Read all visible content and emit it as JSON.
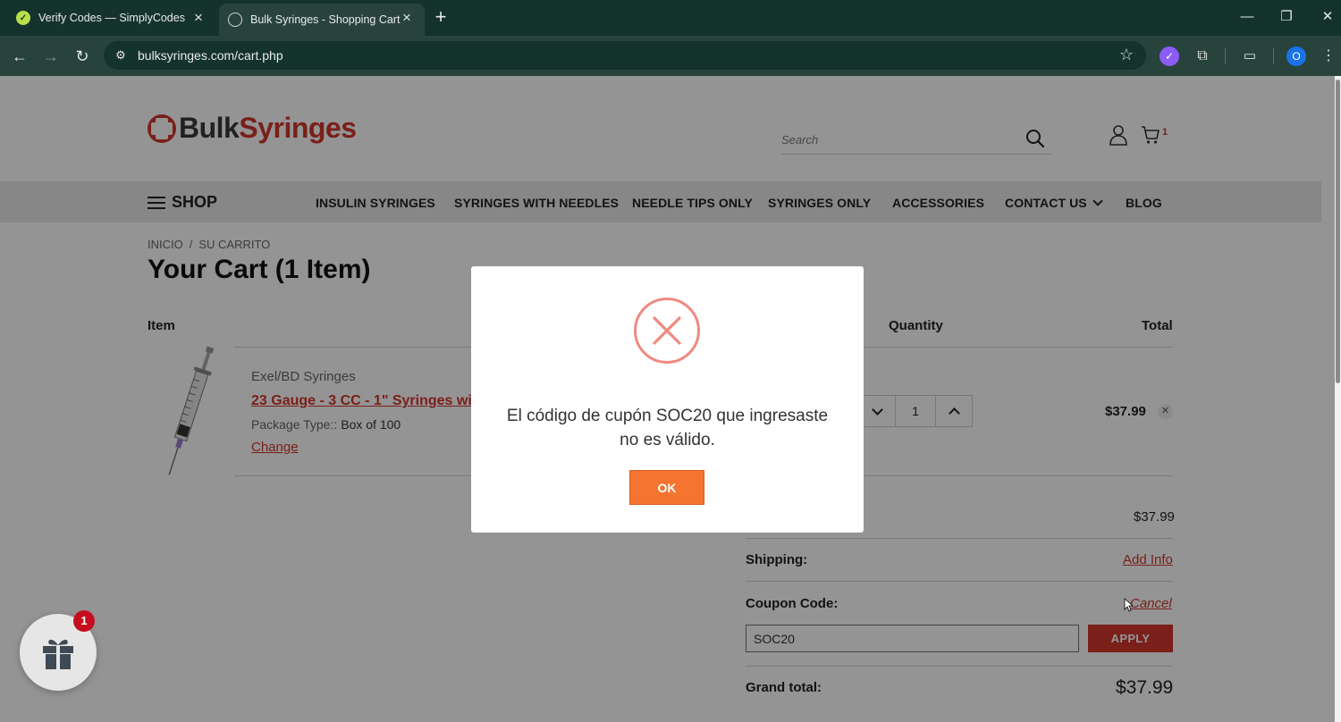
{
  "browser": {
    "tabs": [
      {
        "title": "Verify Codes — SimplyCodes",
        "icon": "simplycodes-icon",
        "active": false
      },
      {
        "title": "Bulk Syringes - Shopping Cart",
        "icon": "globe-icon",
        "active": true
      }
    ],
    "url": "bulksyringes.com/cart.php",
    "profile_initial": "O",
    "accent": "#28433c"
  },
  "header": {
    "logo_part1": "Bulk",
    "logo_part2": "Syringes",
    "search_placeholder": "Search",
    "cart_count": "1"
  },
  "nav": {
    "shop_label": "SHOP",
    "items": [
      "INSULIN SYRINGES",
      "SYRINGES WITH NEEDLES",
      "NEEDLE TIPS ONLY",
      "SYRINGES ONLY",
      "ACCESSORIES",
      "CONTACT US",
      "BLOG"
    ]
  },
  "breadcrumb": [
    "INICIO",
    "SU CARRITO"
  ],
  "cart": {
    "title": "Your Cart (1 Item)",
    "headers": {
      "item": "Item",
      "quantity": "Quantity",
      "total": "Total"
    },
    "item": {
      "brand": "Exel/BD Syringes",
      "name": "23 Gauge - 3 CC - 1\" Syringes with",
      "package_label": "Package Type::",
      "package_value": "Box of 100",
      "change_label": "Change",
      "quantity": "1",
      "total": "$37.99"
    }
  },
  "summary": {
    "subtotal_value": "$37.99",
    "shipping_label": "Shipping:",
    "shipping_link": "Add Info",
    "coupon_label": "Coupon Code:",
    "coupon_cancel": "Cancel",
    "coupon_value": "SOC20",
    "apply_label": "APPLY",
    "grand_label": "Grand total:",
    "grand_value": "$37.99"
  },
  "gift_widget": {
    "badge": "1"
  },
  "modal": {
    "message": "El código de cupón SOC20 que ingresaste no es válido.",
    "ok_label": "OK",
    "icon": "error-x-icon",
    "icon_color": "#f08a80",
    "button_color": "#f47430"
  },
  "colors": {
    "brand_red": "#d2362c"
  }
}
